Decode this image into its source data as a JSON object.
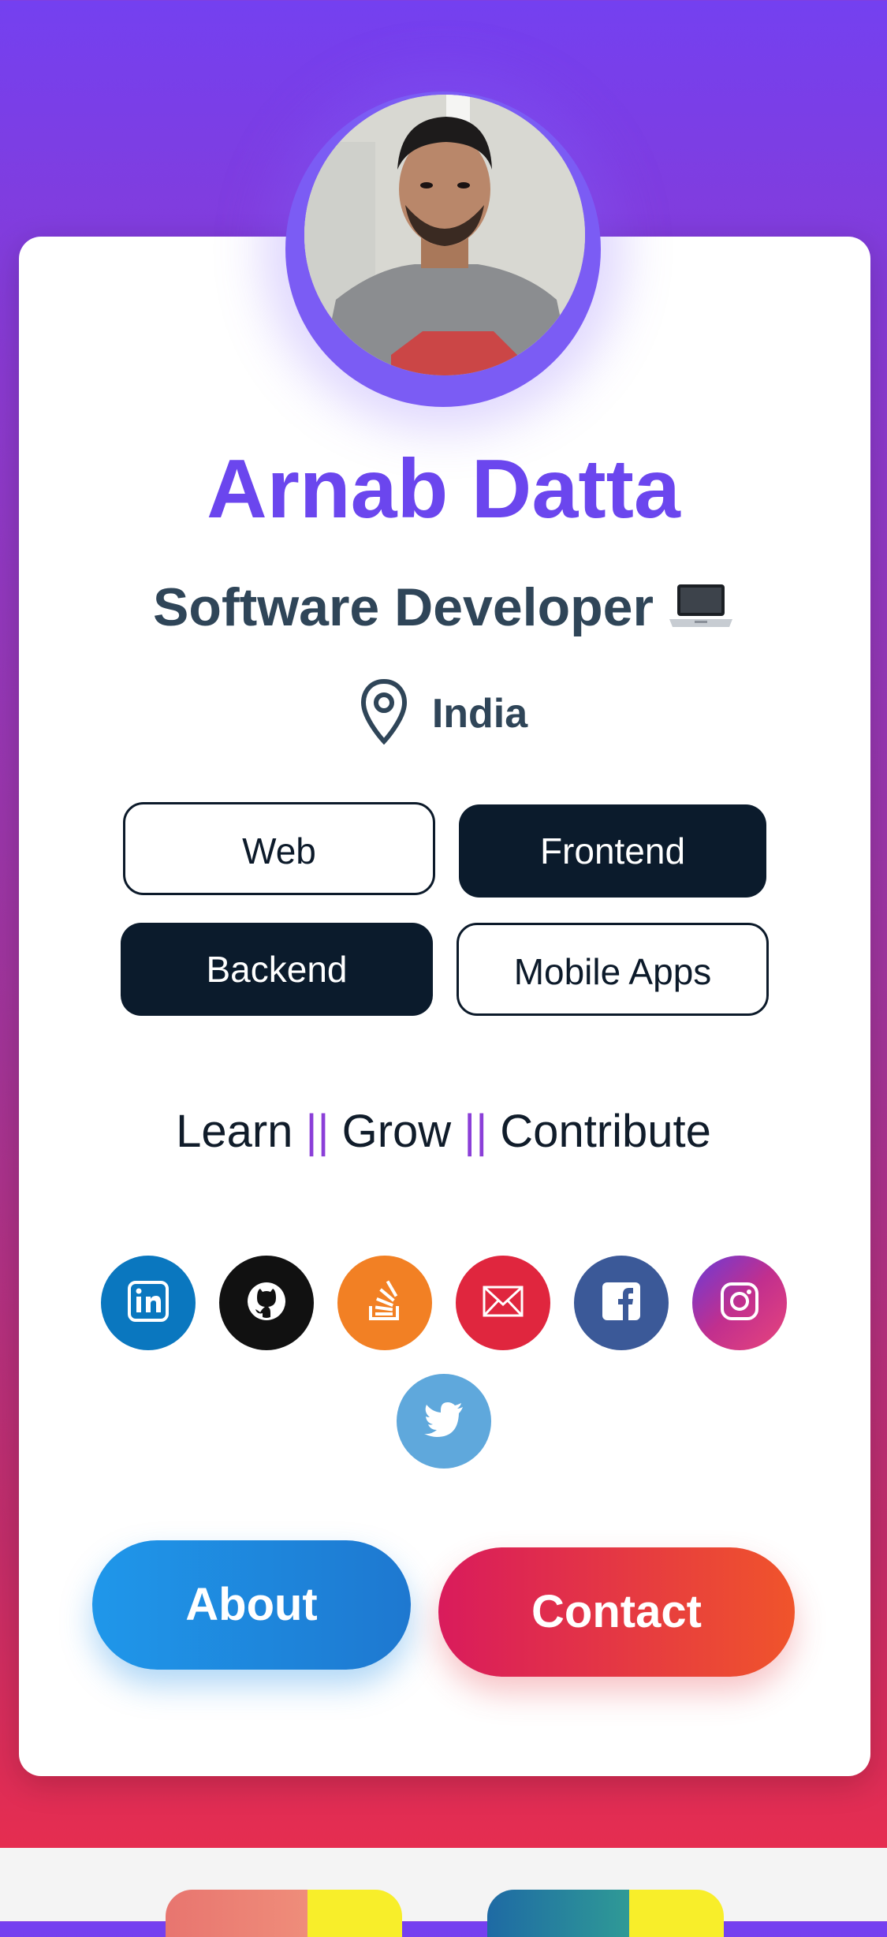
{
  "profile": {
    "name": "Arnab Datta",
    "role": "Software Developer",
    "location": "India"
  },
  "skills": [
    {
      "label": "Web"
    },
    {
      "label": "Frontend"
    },
    {
      "label": "Backend"
    },
    {
      "label": "Mobile Apps"
    }
  ],
  "motto": {
    "part1": "Learn",
    "sep1": "||",
    "part2": "Grow",
    "sep2": "||",
    "part3": "Contribute"
  },
  "social": [
    {
      "icon": "linkedin-icon",
      "color": "#0a77bf"
    },
    {
      "icon": "github-icon",
      "color": "#111111"
    },
    {
      "icon": "stackoverflow-icon",
      "color": "#f28024"
    },
    {
      "icon": "mail-icon",
      "color": "#e0263e"
    },
    {
      "icon": "facebook-icon",
      "color": "#3b5998"
    },
    {
      "icon": "instagram-icon",
      "color": "#a83aa8"
    },
    {
      "icon": "twitter-icon",
      "color": "#5fa8dc"
    }
  ],
  "actions": {
    "about": "About",
    "contact": "Contact"
  },
  "colors": {
    "accent": "#6b46ee",
    "text_dark": "#2f4558",
    "chip_dark": "#0b1b2c"
  }
}
